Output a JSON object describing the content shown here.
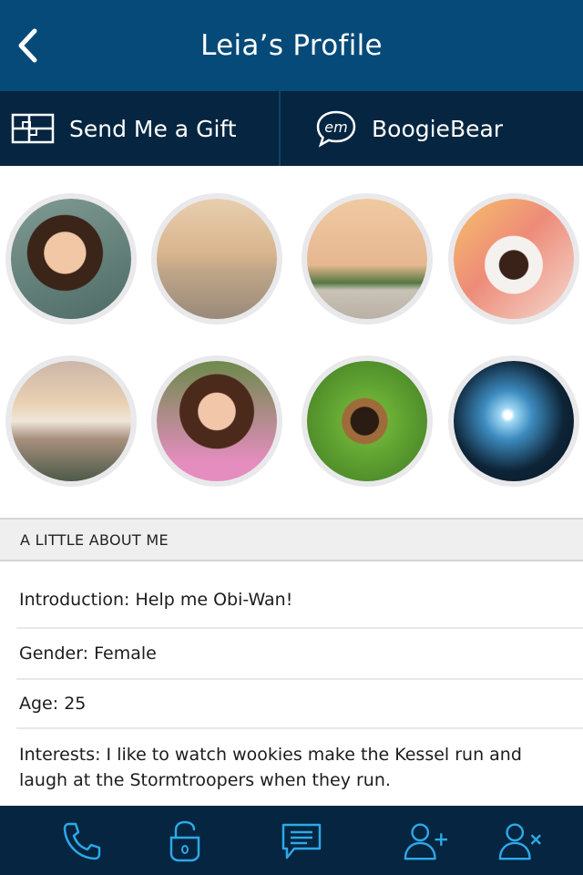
{
  "header": {
    "title": "Leia’s Profile"
  },
  "actions": {
    "gift_label": "Send Me a Gift",
    "username": "BoogieBear"
  },
  "section": {
    "title": "A LITTLE ABOUT ME"
  },
  "about": {
    "introduction": "Introduction: Help me Obi-Wan!",
    "gender": "Gender: Female",
    "age": "Age: 25",
    "interests": "Interests: I like to watch wookies make the Kessel run and laugh at the Stormtroopers when they run."
  },
  "colors": {
    "header": "#054a78",
    "bar": "#052540",
    "accent": "#2da8e8"
  },
  "icons": [
    "back-icon",
    "gift-icon",
    "em-chat-icon",
    "phone-icon",
    "unlock-icon",
    "message-icon",
    "add-user-icon",
    "remove-user-icon"
  ]
}
